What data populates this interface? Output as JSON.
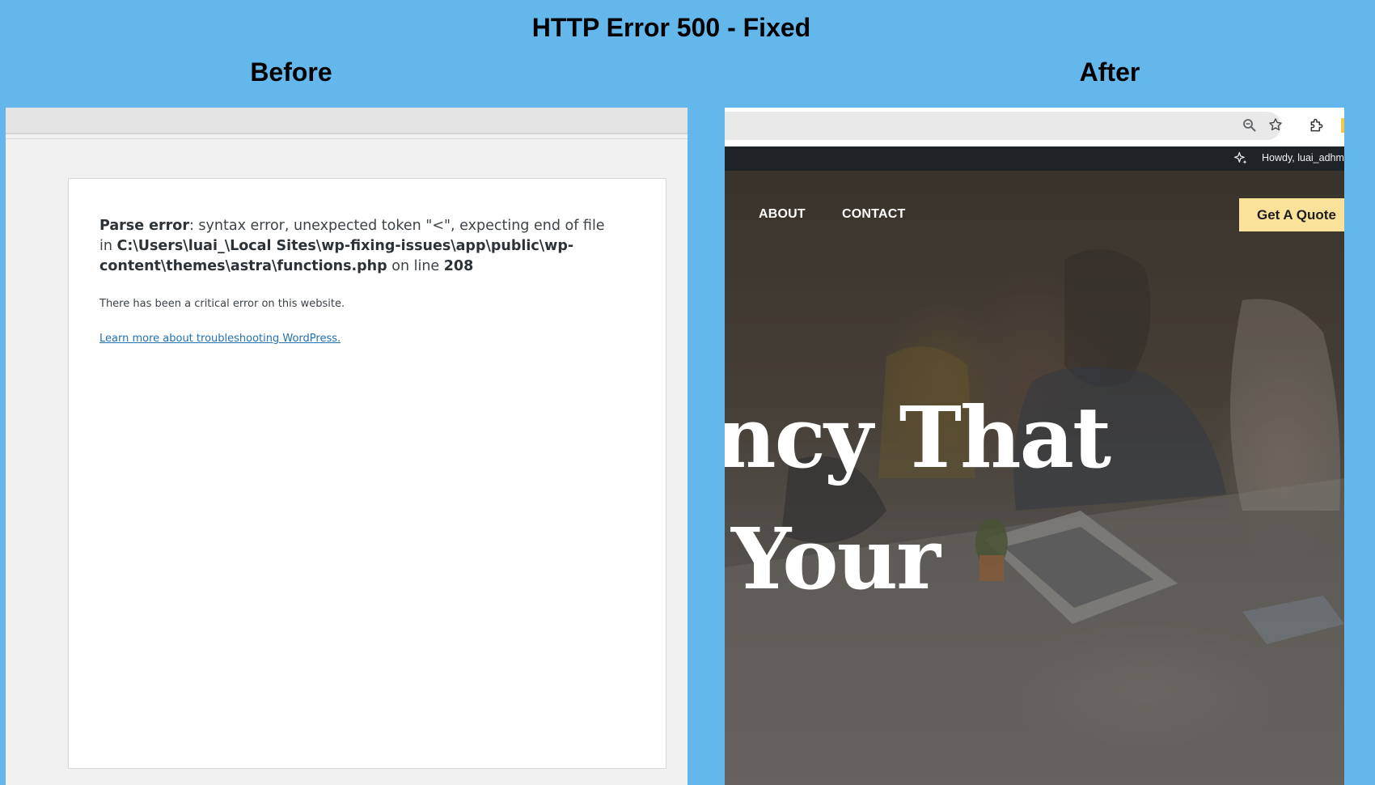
{
  "title": "HTTP Error 500 - Fixed",
  "before": {
    "label": "Before",
    "error": {
      "label_bold": "Parse error",
      "message": ": syntax error, unexpected token \"<\", expecting end of file in ",
      "path": "C:\\Users\\luai_\\Local Sites\\wp-fixing-issues\\app\\public\\wp-content\\themes\\astra\\functions.php",
      "on_line": " on line ",
      "line_number": "208",
      "critical": "There has been a critical error on this website.",
      "link": "Learn more about troubleshooting WordPress."
    }
  },
  "after": {
    "label": "After",
    "browser": {
      "icons": [
        "zoom-icon",
        "star-icon",
        "extensions-icon"
      ]
    },
    "admin_bar": {
      "icon": "sparkle-icon",
      "howdy": "Howdy, luai_adhma"
    },
    "nav": {
      "about": "ABOUT",
      "contact": "CONTACT",
      "cta": "Get A Quote"
    },
    "hero": {
      "line1": "ncy That",
      "line2": "Your"
    }
  },
  "colors": {
    "background": "#64b7ea",
    "admin_bar": "#1d2327",
    "cta": "#fbe29a",
    "link": "#2271b1"
  }
}
